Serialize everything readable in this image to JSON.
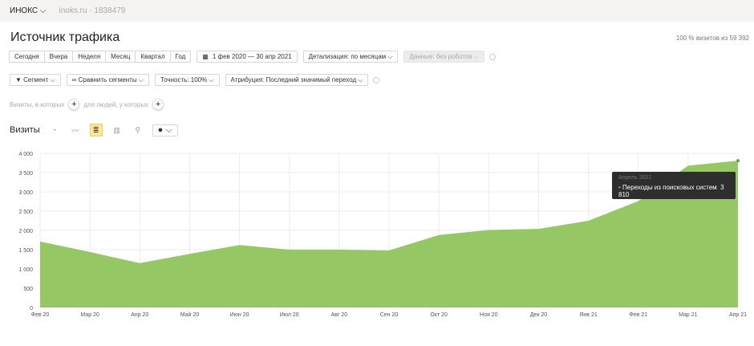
{
  "topbar": {
    "org": "ИНОКС",
    "site": "inoks.ru · 1838479"
  },
  "title": "Источник трафика",
  "share": "100 % визитов из 59 392",
  "periods": [
    "Сегодня",
    "Вчера",
    "Неделя",
    "Месяц",
    "Квартал",
    "Год"
  ],
  "date_range": "1 фев 2020 — 30 апр 2021",
  "detail": "Детализация: по месяцам",
  "robots": "Данные: без роботов",
  "segment": "Сегмент",
  "compare": "Сравнить сегменты",
  "accuracy": "Точность: 100%",
  "attribution": "Атрибуция: Последний значимый переход",
  "filter": {
    "visits_where": "Визиты, в которых",
    "people_where": "для людей, у которых"
  },
  "visits_label": "Визиты",
  "tooltip": {
    "title": "Апрель 2021",
    "series": "Переходы из поисковых систем",
    "value": "3 810"
  },
  "chart_data": {
    "type": "area",
    "categories": [
      "Фев 20",
      "Мар 20",
      "Апр 20",
      "Май 20",
      "Июн 20",
      "Июл 20",
      "Авг 20",
      "Сен 20",
      "Окт 20",
      "Ноя 20",
      "Дек 20",
      "Янв 21",
      "Фев 21",
      "Мар 21",
      "Апр 21"
    ],
    "series": [
      {
        "name": "Переходы из поисковых систем",
        "values": [
          1710,
          1440,
          1150,
          1390,
          1620,
          1500,
          1500,
          1480,
          1880,
          2010,
          2040,
          2250,
          2760,
          3680,
          3810
        ],
        "color": "#95c865"
      }
    ],
    "yticks": [
      "0",
      "500",
      "1 000",
      "1 500",
      "2 000",
      "2 500",
      "3 000",
      "3 500",
      "4 000"
    ],
    "ylim": [
      0,
      4000
    ],
    "grid": true
  }
}
